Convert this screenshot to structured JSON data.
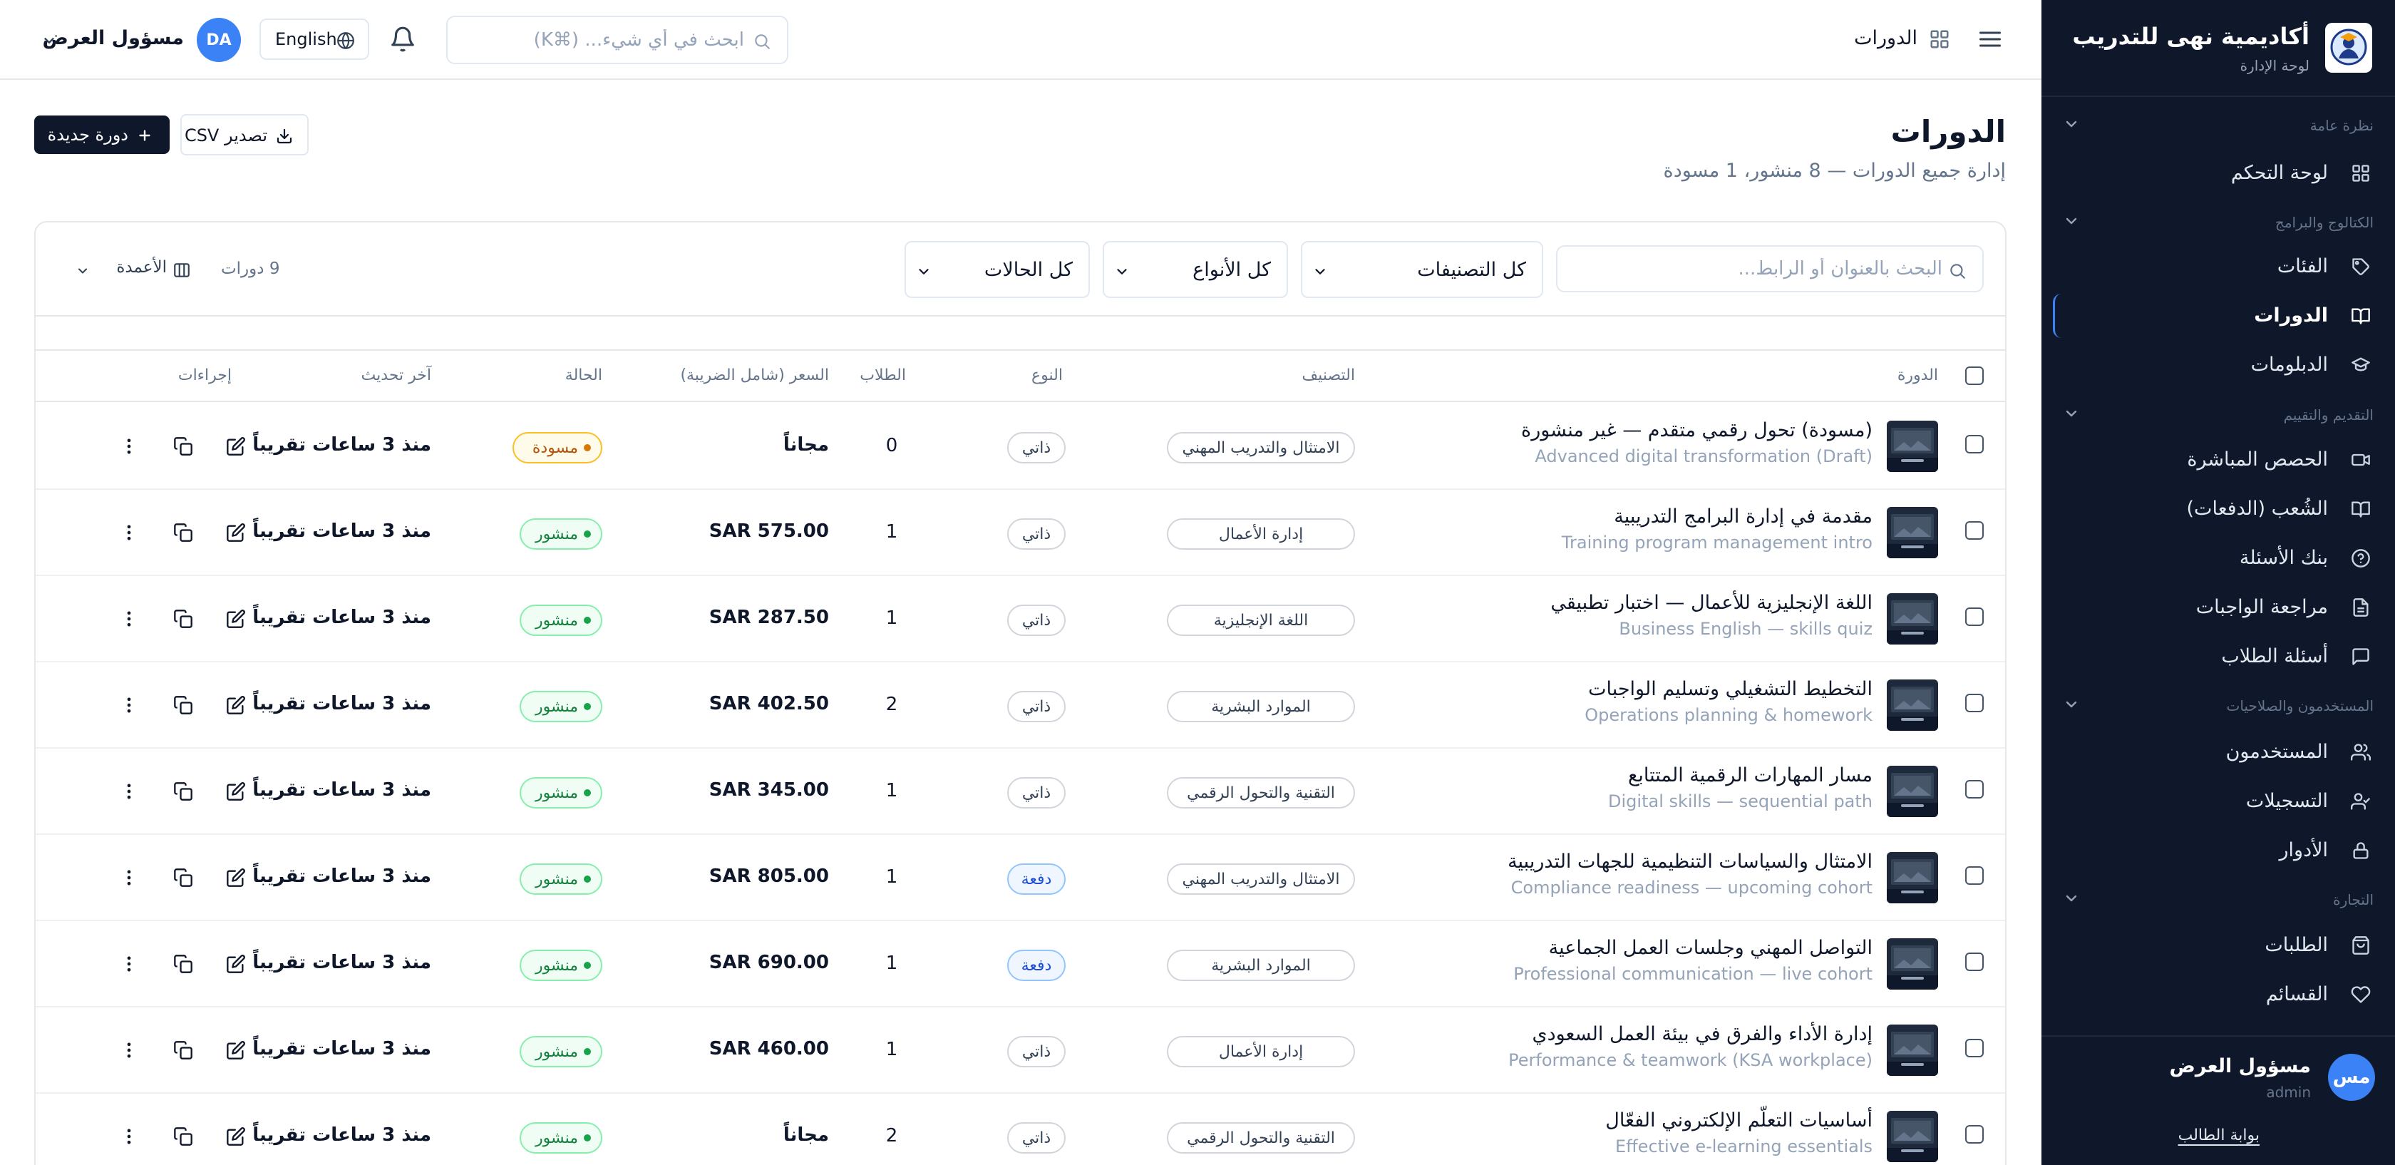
{
  "brand": {
    "title": "أكاديمية نهى للتدريب",
    "subtitle": "لوحة الإدارة"
  },
  "colors": {
    "sidebar_bg": "#0f172a",
    "accent": "#3b82f6",
    "published": "#16a34a",
    "draft": "#d97706",
    "primary_button": "#0f172a"
  },
  "sidebar": {
    "sections": [
      {
        "label": "نظرة عامة",
        "items": [
          {
            "label": "لوحة التحكم",
            "icon": "dashboard-grid-icon"
          }
        ]
      },
      {
        "label": "الكتالوج والبرامج",
        "items": [
          {
            "label": "الفئات",
            "icon": "tag-icon"
          },
          {
            "label": "الدورات",
            "icon": "book-open-icon",
            "active": true
          },
          {
            "label": "الدبلومات",
            "icon": "graduation-cap-icon"
          }
        ]
      },
      {
        "label": "التقديم والتقييم",
        "items": [
          {
            "label": "الحصص المباشرة",
            "icon": "video-icon"
          },
          {
            "label": "الشُعب (الدفعات)",
            "icon": "book-icon"
          },
          {
            "label": "بنك الأسئلة",
            "icon": "help-circle-icon"
          },
          {
            "label": "مراجعة الواجبات",
            "icon": "file-text-icon"
          },
          {
            "label": "أسئلة الطلاب",
            "icon": "message-square-icon"
          }
        ]
      },
      {
        "label": "المستخدمون والصلاحيات",
        "items": [
          {
            "label": "المستخدمون",
            "icon": "users-icon"
          },
          {
            "label": "التسجيلات",
            "icon": "user-check-icon"
          },
          {
            "label": "الأدوار",
            "icon": "lock-icon"
          }
        ]
      },
      {
        "label": "التجارة",
        "items": [
          {
            "label": "الطلبات",
            "icon": "shopping-bag-icon"
          },
          {
            "label": "القسائم",
            "icon": "heart-icon"
          }
        ]
      }
    ],
    "user": {
      "initials": "مس",
      "name": "مسؤول العرض",
      "role": "admin"
    },
    "portal_link": "بوابة الطالب"
  },
  "topbar": {
    "breadcrumb": "الدورات",
    "search_placeholder": "ابحث في أي شيء... (⌘K)",
    "language": "English",
    "user": {
      "initials": "DA",
      "name": "مسؤول العرض"
    }
  },
  "page": {
    "title": "الدورات",
    "subtitle": "إدارة جميع الدورات — 8 منشور، 1 مسودة",
    "export_label": "تصدير CSV",
    "new_label": "دورة جديدة"
  },
  "filters": {
    "search_placeholder": "البحث بالعنوان أو الرابط...",
    "category": "كل التصنيفات",
    "type": "كل الأنواع",
    "status": "كل الحالات",
    "count": "9 دورات",
    "columns": "الأعمدة"
  },
  "table": {
    "headers": {
      "course": "الدورة",
      "category": "التصنيف",
      "type": "النوع",
      "students": "الطلاب",
      "price": "السعر (شامل الضريبة)",
      "status": "الحالة",
      "updated": "آخر تحديث",
      "actions": "إجراءات"
    },
    "rows": [
      {
        "title": "(مسودة) تحول رقمي متقدم — غير منشورة",
        "subtitle": "(Draft) Advanced digital transformation",
        "category": "الامتثال والتدريب المهني",
        "type": "ذاتي",
        "students": "0",
        "price": "مجاناً",
        "status": "مسودة",
        "status_kind": "draft",
        "updated": "منذ 3 ساعات تقريباً"
      },
      {
        "title": "مقدمة في إدارة البرامج التدريبية",
        "subtitle": "Training program management intro",
        "category": "إدارة الأعمال",
        "type": "ذاتي",
        "students": "1",
        "price": "SAR 575.00",
        "status": "منشور",
        "status_kind": "published",
        "updated": "منذ 3 ساعات تقريباً"
      },
      {
        "title": "اللغة الإنجليزية للأعمال — اختبار تطبيقي",
        "subtitle": "Business English — skills quiz",
        "category": "اللغة الإنجليزية",
        "type": "ذاتي",
        "students": "1",
        "price": "SAR 287.50",
        "status": "منشور",
        "status_kind": "published",
        "updated": "منذ 3 ساعات تقريباً"
      },
      {
        "title": "التخطيط التشغيلي وتسليم الواجبات",
        "subtitle": "Operations planning & homework",
        "category": "الموارد البشرية",
        "type": "ذاتي",
        "students": "2",
        "price": "SAR 402.50",
        "status": "منشور",
        "status_kind": "published",
        "updated": "منذ 3 ساعات تقريباً"
      },
      {
        "title": "مسار المهارات الرقمية المتتابع",
        "subtitle": "Digital skills — sequential path",
        "category": "التقنية والتحول الرقمي",
        "type": "ذاتي",
        "students": "1",
        "price": "SAR 345.00",
        "status": "منشور",
        "status_kind": "published",
        "updated": "منذ 3 ساعات تقريباً"
      },
      {
        "title": "الامتثال والسياسات التنظيمية للجهات التدريبية",
        "subtitle": "Compliance readiness — upcoming cohort",
        "category": "الامتثال والتدريب المهني",
        "type": "دفعة",
        "students": "1",
        "price": "SAR 805.00",
        "status": "منشور",
        "status_kind": "published",
        "updated": "منذ 3 ساعات تقريباً"
      },
      {
        "title": "التواصل المهني وجلسات العمل الجماعية",
        "subtitle": "Professional communication — live cohort",
        "category": "الموارد البشرية",
        "type": "دفعة",
        "students": "1",
        "price": "SAR 690.00",
        "status": "منشور",
        "status_kind": "published",
        "updated": "منذ 3 ساعات تقريباً"
      },
      {
        "title": "إدارة الأداء والفرق في بيئة العمل السعودي",
        "subtitle": "Performance & teamwork (KSA workplace)",
        "category": "إدارة الأعمال",
        "type": "ذاتي",
        "students": "1",
        "price": "SAR 460.00",
        "status": "منشور",
        "status_kind": "published",
        "updated": "منذ 3 ساعات تقريباً"
      },
      {
        "title": "أساسيات التعلّم الإلكتروني الفعّال",
        "subtitle": "Effective e-learning essentials",
        "category": "التقنية والتحول الرقمي",
        "type": "ذاتي",
        "students": "2",
        "price": "مجاناً",
        "status": "منشور",
        "status_kind": "published",
        "updated": "منذ 3 ساعات تقريباً"
      }
    ]
  }
}
